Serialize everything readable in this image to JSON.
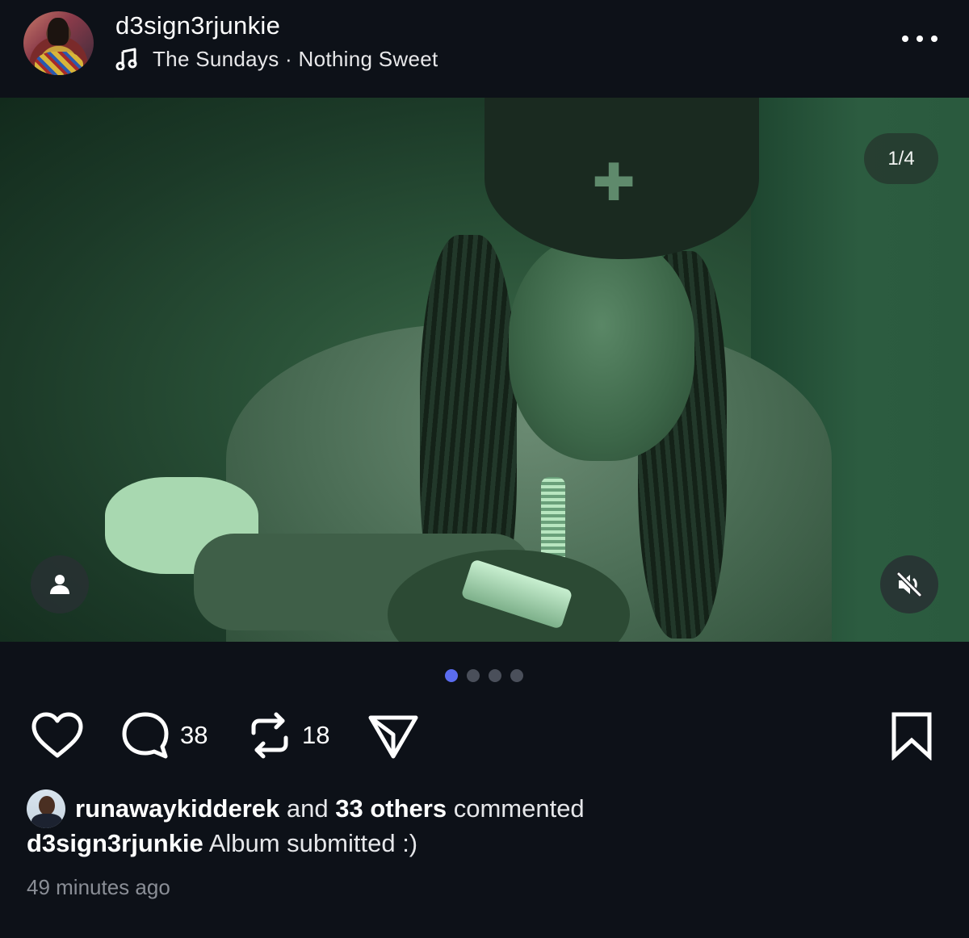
{
  "post": {
    "author": "d3sign3rjunkie",
    "music": {
      "icon": "music-note-icon",
      "text": "The Sundays · Nothing Sweet"
    },
    "media": {
      "counter": "1/4",
      "current_index": 1,
      "total": 4
    },
    "actions": {
      "comments_count": "38",
      "reposts_count": "18"
    },
    "activity": {
      "commenter": "runawaykidderek",
      "and_text": " and ",
      "others": "33 others",
      "suffix": " commented"
    },
    "caption": {
      "author": "d3sign3rjunkie",
      "text": " Album submitted :)"
    },
    "timestamp": "49 minutes ago"
  },
  "colors": {
    "background": "#0d1118",
    "active_dot": "#5a6cf0",
    "inactive_dot": "#4a4f5a",
    "muted_text": "#8a8e96"
  },
  "icons": {
    "more": "more-horizontal-icon",
    "tag": "person-tag-icon",
    "mute": "speaker-muted-icon",
    "like": "heart-icon",
    "comment": "comment-bubble-icon",
    "repost": "repost-icon",
    "share": "send-icon",
    "save": "bookmark-icon"
  }
}
